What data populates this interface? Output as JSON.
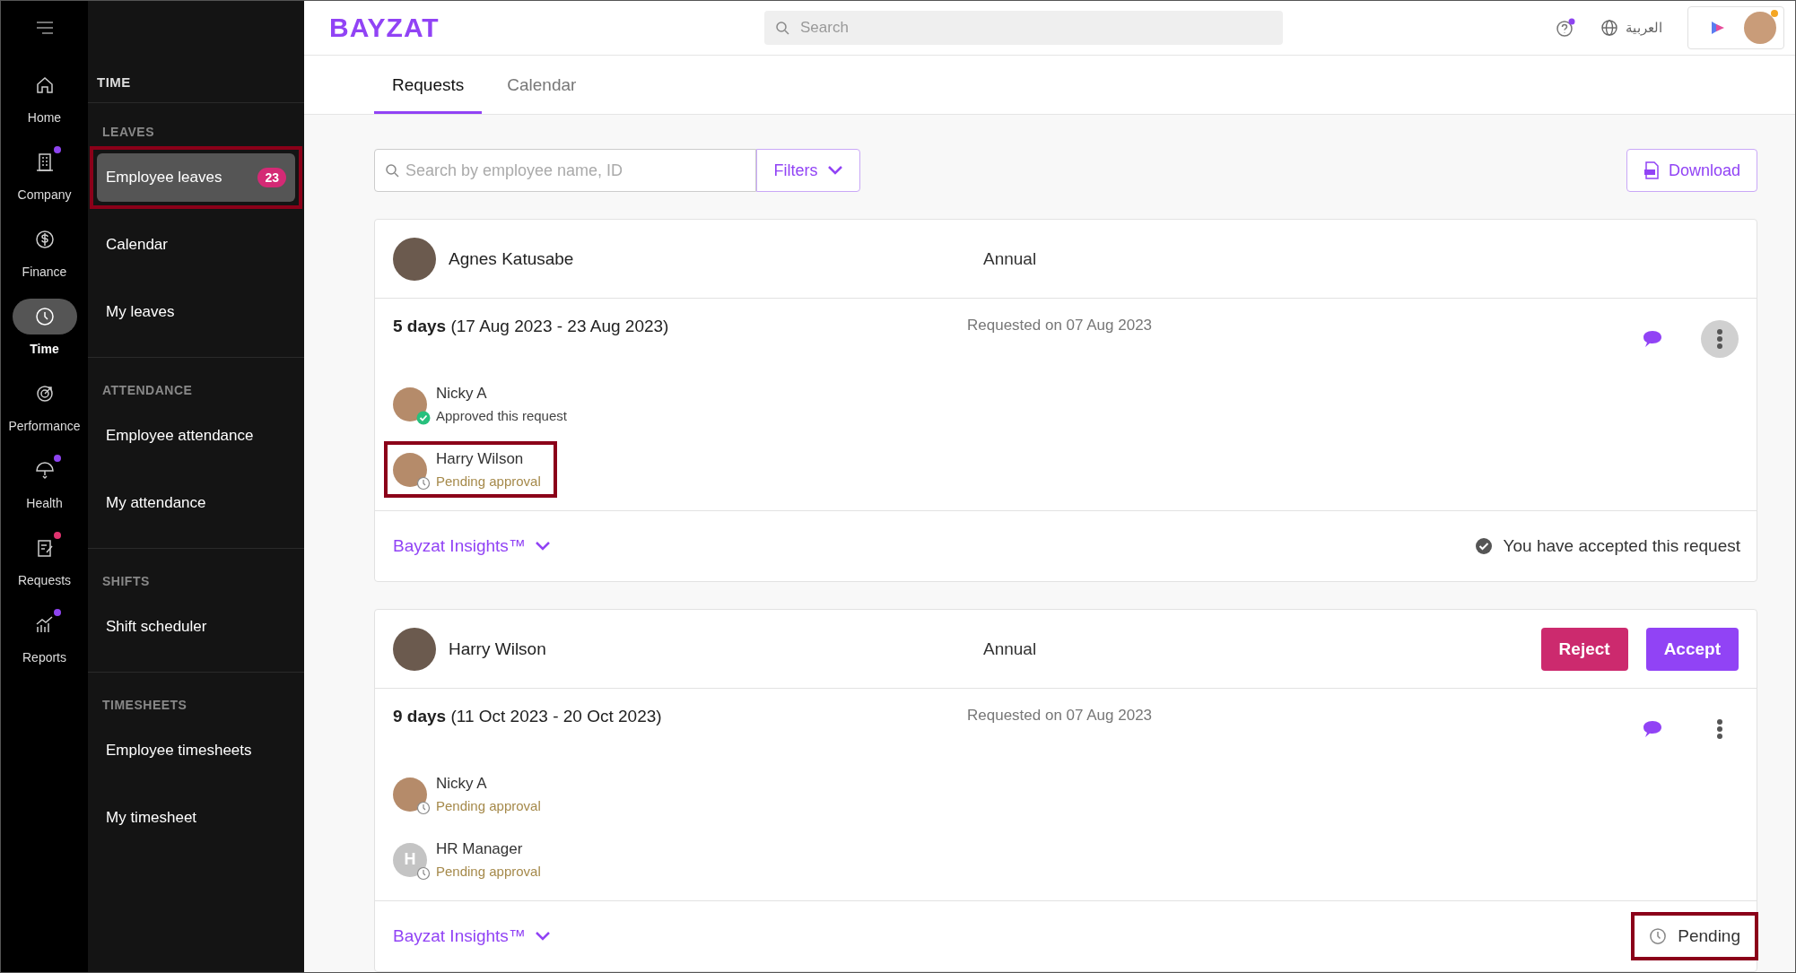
{
  "rail": {
    "items": [
      {
        "label": "Home",
        "selected": false
      },
      {
        "label": "Company",
        "selected": false,
        "color": "#8e44f0"
      },
      {
        "label": "Finance",
        "selected": false
      },
      {
        "label": "Time",
        "selected": true
      },
      {
        "label": "Performance",
        "selected": false
      },
      {
        "label": "Health",
        "selected": false,
        "color": "#8e44f0"
      },
      {
        "label": "Requests",
        "selected": false,
        "color": "#e0336f"
      },
      {
        "label": "Reports",
        "selected": false,
        "color": "#8e44f0"
      }
    ]
  },
  "sidebar": {
    "title": "TIME",
    "sections": [
      {
        "label": "LEAVES",
        "items": [
          {
            "label": "Employee leaves",
            "badge": "23",
            "selected": true,
            "highlighted": true
          },
          {
            "label": "Calendar",
            "selected": false,
            "highlighted": false
          },
          {
            "label": "My leaves",
            "selected": false,
            "highlighted": false
          }
        ]
      },
      {
        "label": "ATTENDANCE",
        "items": [
          {
            "label": "Employee attendance",
            "selected": false,
            "highlighted": false
          },
          {
            "label": "My attendance",
            "selected": false,
            "highlighted": false
          }
        ]
      },
      {
        "label": "SHIFTS",
        "items": [
          {
            "label": "Shift scheduler",
            "selected": false,
            "highlighted": false
          }
        ]
      },
      {
        "label": "TIMESHEETS",
        "items": [
          {
            "label": "Employee timesheets",
            "selected": false,
            "highlighted": false
          },
          {
            "label": "My timesheet",
            "selected": false,
            "highlighted": false
          }
        ]
      }
    ]
  },
  "header": {
    "logo": "BAYZAT",
    "search": {
      "placeholder": "Search"
    },
    "language": "العربية"
  },
  "tabs": [
    {
      "label": "Requests",
      "selected": true
    },
    {
      "label": "Calendar",
      "selected": false
    }
  ],
  "toolbar": {
    "search": {
      "placeholder": "Search by employee name, ID"
    },
    "filters": "Filters",
    "download": "Download"
  },
  "requests": [
    {
      "employee": "Agnes Katusabe",
      "type": "Annual",
      "duration": "5 days",
      "dates": "(17 Aug 2023 - 23 Aug 2023)",
      "requested": "Requested on 07 Aug 2023",
      "more_active": true,
      "approvers": [
        {
          "name": "Nicky A",
          "kind": "approved",
          "note": "Approved this request",
          "highlighted": false
        },
        {
          "name": "Harry Wilson",
          "kind": "pending",
          "note": "Pending approval",
          "highlighted": true
        }
      ],
      "insights": "Bayzat Insights™",
      "outcome": {
        "kind": "accepted",
        "label": "You have accepted this request",
        "highlighted": false
      }
    },
    {
      "employee": "Harry Wilson",
      "type": "Annual",
      "duration": "9 days",
      "dates": "(11 Oct 2023 - 20 Oct 2023)",
      "requested": "Requested on 07 Aug 2023",
      "actions": [
        {
          "kind": "reject",
          "label": "Reject"
        },
        {
          "kind": "accept",
          "label": "Accept"
        }
      ],
      "more_active": false,
      "approvers": [
        {
          "name": "Nicky A",
          "kind": "pending",
          "note": "Pending approval",
          "highlighted": false
        },
        {
          "name": "HR Manager",
          "initial": "H",
          "kind": "pending",
          "note": "Pending approval",
          "highlighted": false
        }
      ],
      "insights": "Bayzat Insights™",
      "outcome": {
        "kind": "pending",
        "label": "Pending",
        "highlighted": true
      }
    }
  ]
}
